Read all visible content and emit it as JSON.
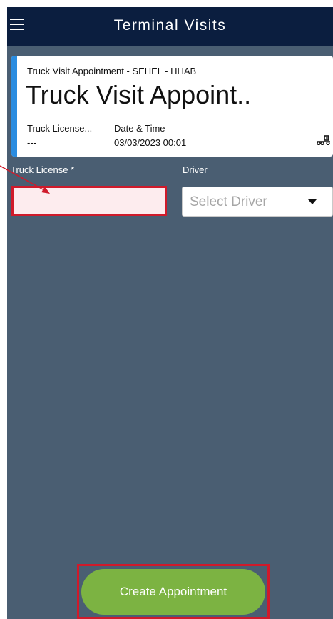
{
  "app_bar": {
    "title": "Terminal Visits",
    "menu_icon": "hamburger-menu-icon"
  },
  "card": {
    "subtitle": "Truck Visit Appointment - SEHEL - HHAB",
    "title": "Truck Visit Appoint..",
    "truck_license_label": "Truck License...",
    "truck_license_value": "---",
    "date_time_label": "Date & Time",
    "date_time_value": "03/03/2023 00:01",
    "accent_color": "#2a8ce0",
    "icon": "truck-icon"
  },
  "form": {
    "truck_license_label": "Truck License *",
    "truck_license_value": "",
    "driver_label": "Driver",
    "driver_placeholder": "Select Driver"
  },
  "actions": {
    "create_label": "Create Appointment",
    "create_color": "#7cb342"
  },
  "colors": {
    "app_bar": "#0b1e3f",
    "background": "#4a5e72",
    "highlight": "#d01a2a"
  }
}
